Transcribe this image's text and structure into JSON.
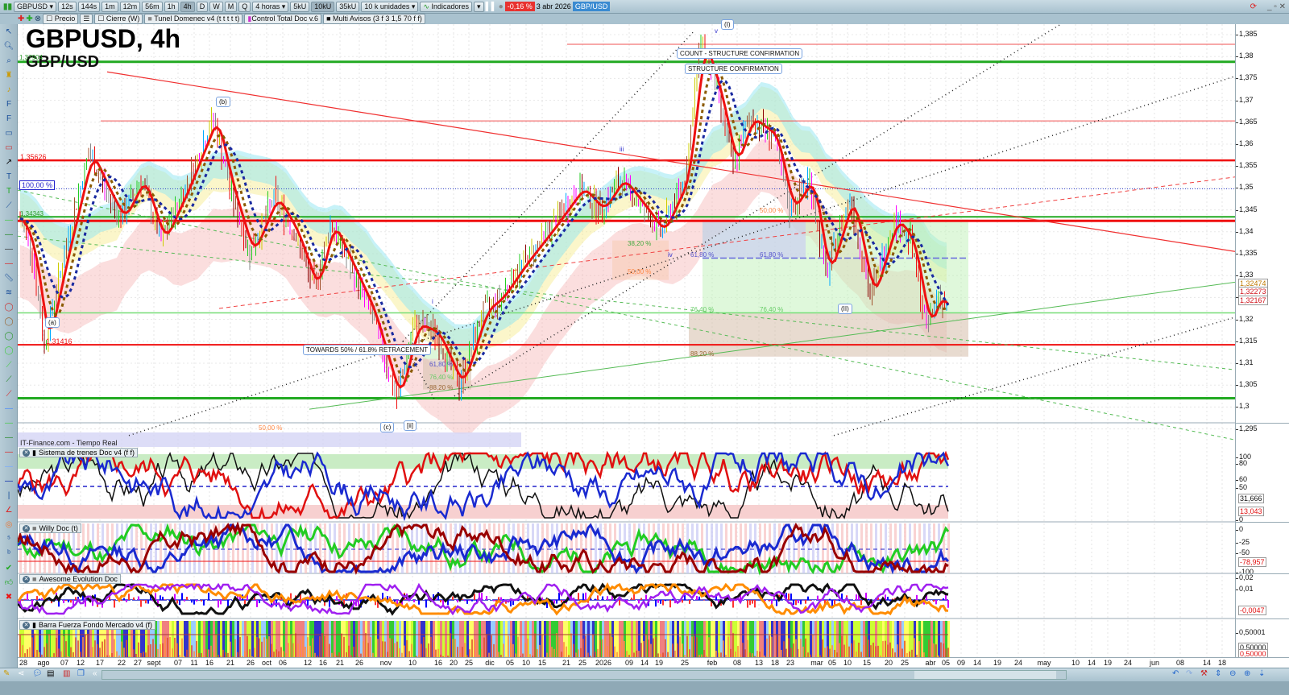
{
  "toolbar": {
    "symbol": "GBPUSD",
    "timeframes": [
      "12s",
      "144s",
      "1m",
      "12m",
      "56m",
      "1h",
      "4h",
      "D",
      "W",
      "M",
      "Q"
    ],
    "active_timeframe": "4h",
    "period": "4 horas",
    "units": [
      "5kU",
      "10kU",
      "35kU"
    ],
    "active_unit": "10kU",
    "unit_select": "10 k unidades",
    "indicators": "Indicadores",
    "change": "-0,16 %",
    "date": "3 abr 2026",
    "pair": "GBP/USD"
  },
  "legend": [
    "Precio",
    "Cierre (W)",
    "Tunel Domenec v4 (t t t t t)",
    "Control Total Doc v.6",
    "Multi Avisos (3 f 3 1,5 70 f f)"
  ],
  "chart": {
    "title": "GBPUSD, 4h",
    "subtitle": "GBP/USD",
    "source": "IT-Finance.com - Tiempo Real",
    "price_ticks": [
      "1,385",
      "1,38",
      "1,375",
      "1,37",
      "1,365",
      "1,36",
      "1,355",
      "1,35",
      "1,345",
      "1,34",
      "1,335",
      "1,33",
      "1,325",
      "1,32",
      "1,315",
      "1,31",
      "1,305",
      "1,3",
      "1,295"
    ],
    "price_labels": [
      {
        "text": "1,32474",
        "color": "#c07a00"
      },
      {
        "text": "1,32273",
        "color": "#d0121b"
      },
      {
        "text": "1,32167",
        "color": "#d0121b"
      }
    ],
    "level_labels": {
      "l1": "1,37904",
      "l2": "1,35626",
      "l3": "1,34343",
      "l4": "1,31416",
      "pct100": "100,00 %"
    },
    "annotations": {
      "count": "COUNT - STRUCTURE CONFIRMATION",
      "structure": "STRUCTURE CONFIRMATION",
      "toward": "TOWARDS 50% / 61.8% RETRACEMENT",
      "wave_i": "(I)",
      "wave_ii": "(II)",
      "wave_b": "(b)",
      "wave_a": "(a)",
      "wave_c": "(c)",
      "wave_ii2": "[ii]",
      "wave_iv": "iv",
      "wave_v": "v",
      "wave_iii": "iii",
      "wave_i2": "i"
    },
    "fibs": {
      "f382": "38,20 %",
      "f50": "50,00 %",
      "f618": "61,80 %",
      "f764": "76,40 %",
      "f882": "88,20 %"
    }
  },
  "panes": [
    {
      "name": "Sistema de trenes Doc v4 (f f)",
      "ticks": [
        "100",
        "80",
        "60",
        "50",
        "0"
      ],
      "labels": [
        {
          "text": "31,666",
          "color": "#111"
        },
        {
          "text": "13,043",
          "color": "#e01010"
        }
      ]
    },
    {
      "name": "Willy Doc (t)",
      "ticks": [
        "0",
        "-25",
        "-50",
        "-100"
      ],
      "labels": [
        {
          "text": "-78,957",
          "color": "#e01010"
        }
      ]
    },
    {
      "name": "Awesome Evolution Doc",
      "ticks": [
        "0,02",
        "0,01"
      ],
      "labels": [
        {
          "text": "-0,0047",
          "color": "#e01010"
        }
      ]
    },
    {
      "name": "Barra Fuerza Fondo Mercado v4 (f)",
      "ticks": [
        "0,50001"
      ],
      "labels": [
        {
          "text": "0,50000",
          "color": "#111"
        },
        {
          "text": "0,50000",
          "color": "#e01010"
        }
      ]
    }
  ],
  "xaxis": [
    "28",
    "ago",
    "07",
    "12",
    "17",
    "22",
    "27",
    "sept",
    "07",
    "11",
    "16",
    "21",
    "26",
    "oct",
    "06",
    "12",
    "16",
    "21",
    "26",
    "nov",
    "10",
    "16",
    "20",
    "25",
    "dic",
    "05",
    "10",
    "15",
    "21",
    "25",
    "2026",
    "09",
    "14",
    "19",
    "25",
    "feb",
    "08",
    "13",
    "18",
    "23",
    "mar",
    "05",
    "10",
    "15",
    "20",
    "25",
    "abr",
    "05",
    "09",
    "14",
    "19",
    "24",
    "may",
    "10",
    "14",
    "19",
    "24",
    "jun",
    "08",
    "14",
    "18"
  ]
}
